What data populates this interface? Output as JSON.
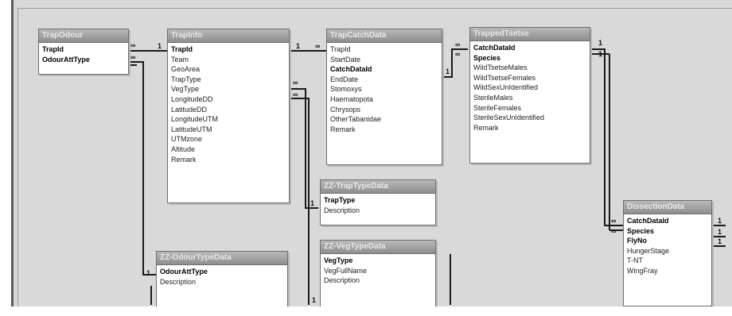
{
  "tables": [
    {
      "id": "trapodour",
      "title": "TrapOdour",
      "fields": [
        {
          "name": "TrapId",
          "key": true
        },
        {
          "name": "OdourAttType",
          "key": true
        }
      ]
    },
    {
      "id": "trapinfo",
      "title": "TrapInfo",
      "fields": [
        {
          "name": "TrapId",
          "key": true
        },
        {
          "name": "Team",
          "key": false
        },
        {
          "name": "GeoArea",
          "key": false
        },
        {
          "name": "TrapType",
          "key": false
        },
        {
          "name": "VegType",
          "key": false
        },
        {
          "name": "LongitudeDD",
          "key": false
        },
        {
          "name": "LatitudeDD",
          "key": false
        },
        {
          "name": "LongitudeUTM",
          "key": false
        },
        {
          "name": "LatitudeUTM",
          "key": false
        },
        {
          "name": "UTMzone",
          "key": false
        },
        {
          "name": "Altitude",
          "key": false
        },
        {
          "name": "Remark",
          "key": false
        }
      ]
    },
    {
      "id": "trapcatchdata",
      "title": "TrapCatchData",
      "fields": [
        {
          "name": "TrapId",
          "key": false
        },
        {
          "name": "StartDate",
          "key": false
        },
        {
          "name": "CatchDataId",
          "key": true
        },
        {
          "name": "EndDate",
          "key": false
        },
        {
          "name": "Stomoxys",
          "key": false
        },
        {
          "name": "Haematopota",
          "key": false
        },
        {
          "name": "Chrysops",
          "key": false
        },
        {
          "name": "OtherTabanidae",
          "key": false
        },
        {
          "name": "Remark",
          "key": false
        }
      ]
    },
    {
      "id": "trappedtsetse",
      "title": "TrappedTsetse",
      "fields": [
        {
          "name": "CatchDataId",
          "key": true
        },
        {
          "name": "Species",
          "key": true
        },
        {
          "name": "WildTsetseMales",
          "key": false
        },
        {
          "name": "WildTsetseFemales",
          "key": false
        },
        {
          "name": "WildSexUnIdentified",
          "key": false
        },
        {
          "name": "SterileMales",
          "key": false
        },
        {
          "name": "SterileFemales",
          "key": false
        },
        {
          "name": "SterileSexUnIdentified",
          "key": false
        },
        {
          "name": "Remark",
          "key": false
        }
      ]
    },
    {
      "id": "zztraptype",
      "title": "ZZ-TrapTypeData",
      "fields": [
        {
          "name": "TrapType",
          "key": true
        },
        {
          "name": "Description",
          "key": false
        }
      ]
    },
    {
      "id": "zzvegtype",
      "title": "ZZ-VegTypeData",
      "fields": [
        {
          "name": "VegType",
          "key": true
        },
        {
          "name": "VegFullName",
          "key": false
        },
        {
          "name": "Description",
          "key": false
        }
      ]
    },
    {
      "id": "zzodourtype",
      "title": "ZZ-OdourTypeData",
      "fields": [
        {
          "name": "OdourAttType",
          "key": true
        },
        {
          "name": "Description",
          "key": false
        }
      ]
    },
    {
      "id": "dissection",
      "title": "DissectionData",
      "fields": [
        {
          "name": "CatchDataId",
          "key": true
        },
        {
          "name": "Species",
          "key": true
        },
        {
          "name": "FlyNo",
          "key": true
        },
        {
          "name": "HungerStage",
          "key": false
        },
        {
          "name": "T-NT",
          "key": false
        },
        {
          "name": "WingFray",
          "key": false
        }
      ]
    }
  ],
  "relationship_labels": {
    "one": "1",
    "many": "∞"
  }
}
